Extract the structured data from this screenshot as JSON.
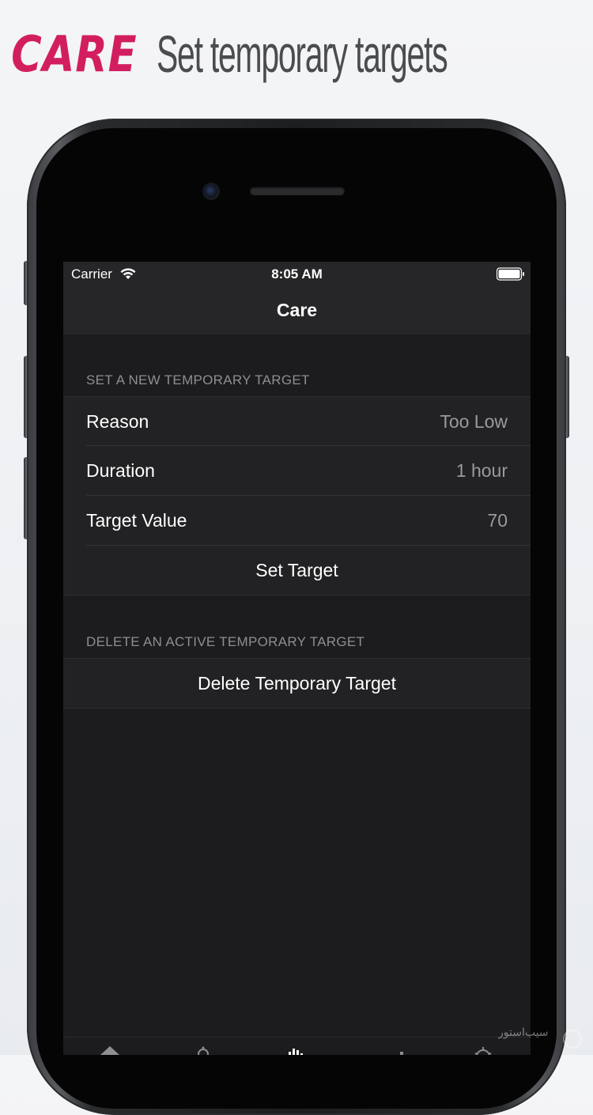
{
  "promo": {
    "brand": "CARE",
    "tagline": "Set temporary targets"
  },
  "status_bar": {
    "carrier": "Carrier",
    "time": "8:05 AM",
    "wifi_icon": "wifi-icon",
    "battery_icon": "battery-icon"
  },
  "nav": {
    "title": "Care"
  },
  "new_target_section": {
    "header": "SET A NEW TEMPORARY TARGET",
    "rows": [
      {
        "label": "Reason",
        "value": "Too Low"
      },
      {
        "label": "Duration",
        "value": "1 hour"
      },
      {
        "label": "Target Value",
        "value": "70"
      }
    ],
    "action": "Set Target"
  },
  "delete_section": {
    "header": "DELETE AN ACTIVE TEMPORARY TARGET",
    "action": "Delete Temporary Target"
  },
  "tab_bar": {
    "icons": [
      "home-icon",
      "bell-icon",
      "chart-icon",
      "bar-icon",
      "gear-icon"
    ]
  },
  "watermark": {
    "text": "سیب‌استور"
  },
  "colors": {
    "brand": "#d21e5f",
    "screen_bg": "#1c1c1e",
    "cell_bg": "#222224",
    "secondary_text": "#8e8e93"
  }
}
